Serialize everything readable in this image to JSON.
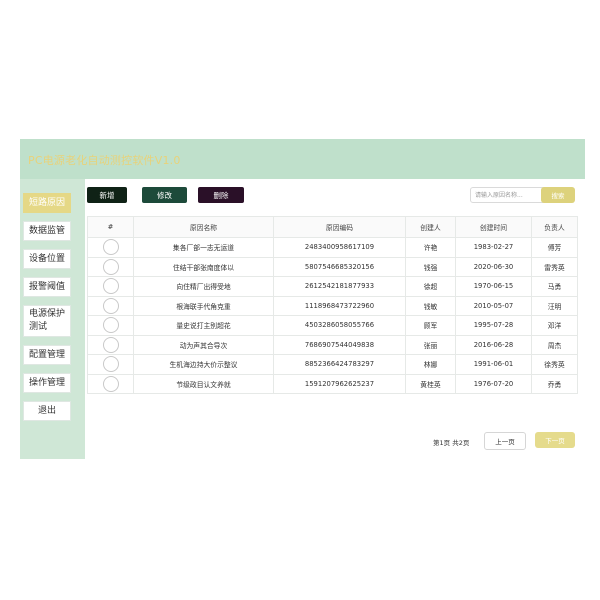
{
  "app": {
    "title": "PC电源老化自动测控软件V1.0"
  },
  "sidebar": {
    "items": [
      {
        "label": "短路原因",
        "active": true
      },
      {
        "label": "数据监管"
      },
      {
        "label": "设备位置"
      },
      {
        "label": "报警阈值"
      },
      {
        "label": "电源保护\n测试"
      },
      {
        "label": "配置管理"
      },
      {
        "label": "操作管理"
      },
      {
        "label": "退出"
      }
    ]
  },
  "toolbar": {
    "add_label": "新增",
    "edit_label": "修改",
    "delete_label": "删除",
    "search_placeholder": "请输入原因名称...",
    "search_label": "搜索"
  },
  "table": {
    "headers": [
      "#",
      "原因名称",
      "原因编码",
      "创建人",
      "创建时间",
      "负责人"
    ],
    "rows": [
      [
        "集各厂部一志无运道",
        "2483400958617109",
        "许艳",
        "1983-02-27",
        "傅芳"
      ],
      [
        "住结干部张南度体以",
        "5807546685320156",
        "钱强",
        "2020-06-30",
        "雷秀英"
      ],
      [
        "向住精厂出得受地",
        "2612542181877933",
        "徐超",
        "1970-06-15",
        "马勇"
      ],
      [
        "根海联手代角克重",
        "1118968473722960",
        "钱敏",
        "2010-05-07",
        "汪明"
      ],
      [
        "量史说打主别超花",
        "4503286058055766",
        "顾军",
        "1995-07-28",
        "邓洋"
      ],
      [
        "动为声其合导次",
        "7686907544049838",
        "张丽",
        "2016-06-28",
        "周杰"
      ],
      [
        "生机海边持大价示整议",
        "8852366424783297",
        "林娜",
        "1991-06-01",
        "徐秀英"
      ],
      [
        "节级政目认文养就",
        "1591207962625237",
        "黄桂英",
        "1976-07-20",
        "乔勇"
      ]
    ]
  },
  "pager": {
    "info": "第1页 共2页",
    "prev_label": "上一页",
    "next_label": "下一页"
  },
  "colors": {
    "sidebar_bg": "#cfe7d6",
    "titlebar_bg": "#bfe0cb",
    "title_text": "#e8d27a",
    "active_nav": "#e5d886",
    "accent": "#ddd27c"
  }
}
